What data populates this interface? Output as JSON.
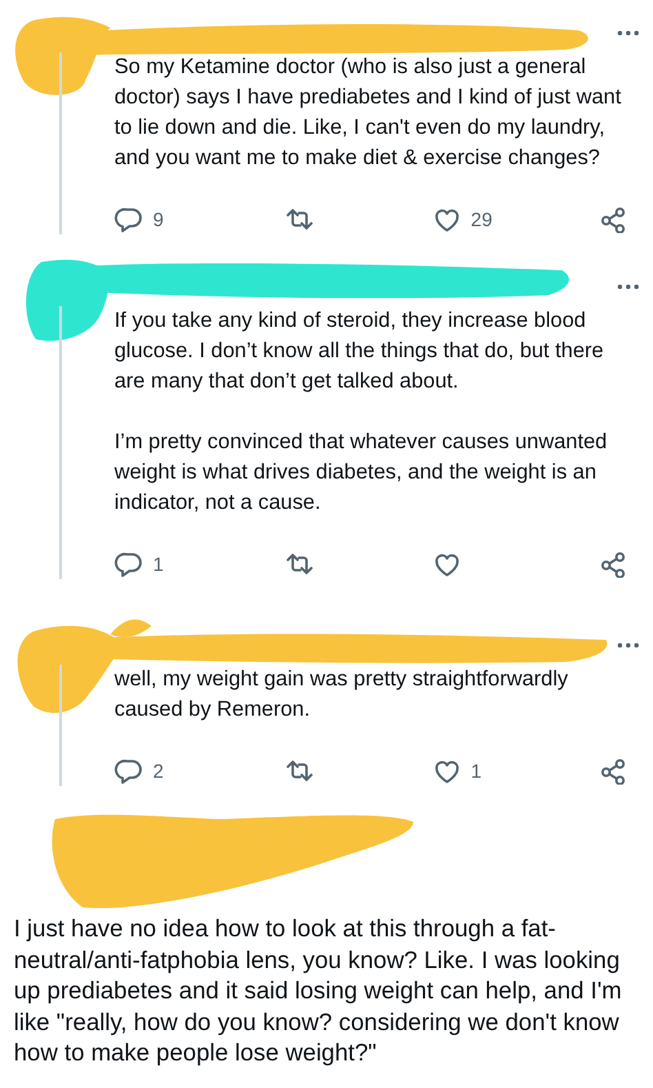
{
  "posts": [
    {
      "kind": "reply",
      "color": "#f9c23c",
      "paragraphs": [
        "So my Ketamine doctor (who is also just a general doctor) says I have prediabetes and I kind of just want to lie down and die. Like, I can't even do my laundry, and you want me to make diet & exercise changes?"
      ],
      "replies": "9",
      "likes": "29"
    },
    {
      "kind": "reply",
      "color": "#2ee6cf",
      "paragraphs": [
        "If you take any kind of steroid, they increase blood glucose. I don’t know all the things that do, but there are many that don’t get talked about.",
        "I’m pretty convinced that whatever causes unwanted weight is what drives diabetes, and the weight is an indicator, not a cause."
      ],
      "replies": "1"
    },
    {
      "kind": "reply",
      "color": "#f9c23c",
      "paragraphs": [
        "well, my weight gain was pretty straightforwardly caused by Remeron."
      ],
      "replies": "2",
      "likes": "1"
    },
    {
      "kind": "main",
      "color": "#f9c23c",
      "paragraphs": [
        "I just have no idea how to look at this through a fat-neutral/anti-fatphobia lens, you know? Like. I was looking up prediabetes and it said losing weight can help, and I'm like \"really, how do you know? considering we don't know how to make people lose weight?\""
      ]
    }
  ]
}
